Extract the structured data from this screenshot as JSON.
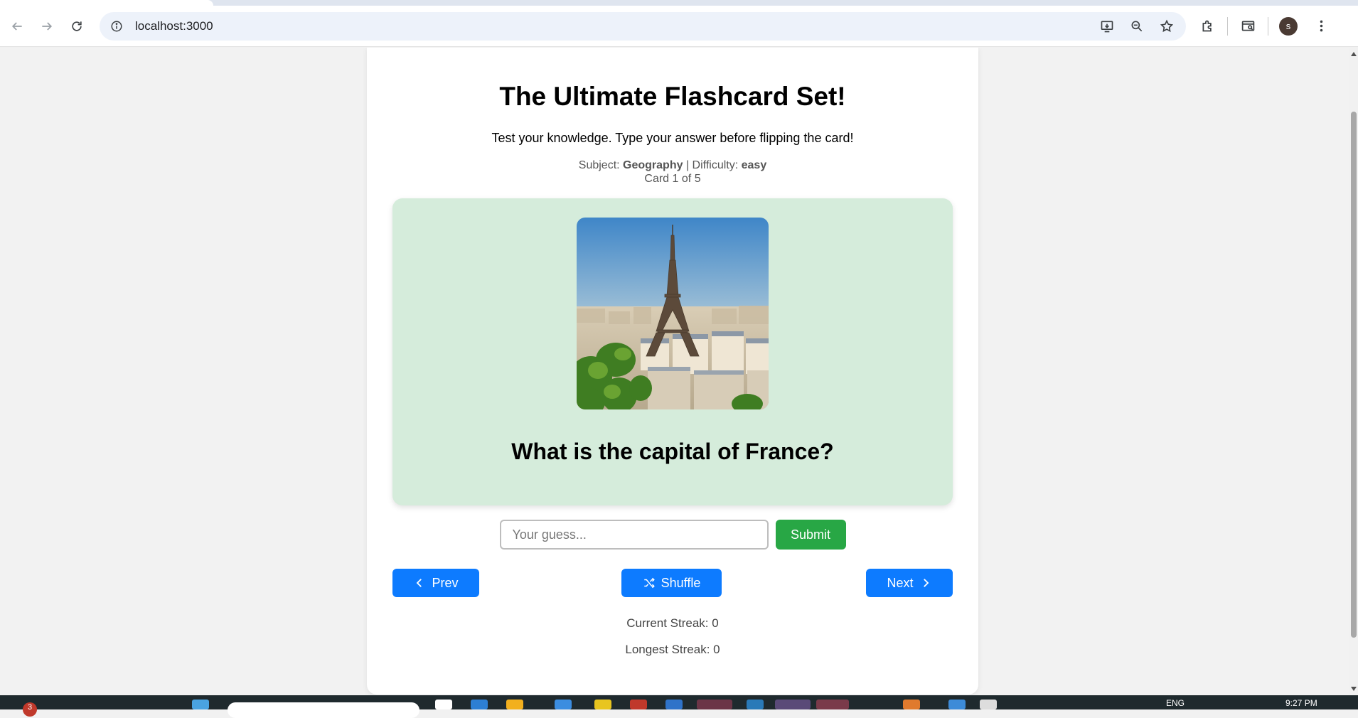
{
  "browser": {
    "url": "localhost:3000",
    "avatar_letter": "s"
  },
  "page": {
    "title": "The Ultimate Flashcard Set!",
    "subtitle": "Test your knowledge. Type your answer before flipping the card!",
    "subject_label": "Subject:",
    "subject_value": "Geography",
    "difficulty_label": "| Difficulty:",
    "difficulty_value": "easy",
    "card_word": "Card",
    "card_current": "1",
    "card_of": "of",
    "card_total": "5"
  },
  "card": {
    "image_icon": "eiffel-tower-photo",
    "question": "What is the capital of France?",
    "background_color": "#d5ecdb"
  },
  "guess": {
    "placeholder": "Your guess...",
    "value": "",
    "submit_label": "Submit"
  },
  "controls": {
    "prev_label": "Prev",
    "shuffle_label": "Shuffle",
    "next_label": "Next",
    "accent_color": "#0d7bff",
    "submit_color": "#28a745"
  },
  "streaks": {
    "current_label": "Current Streak: 0",
    "longest_label": "Longest Streak: 0"
  },
  "taskbar": {
    "badge_count": "3",
    "language": "ENG",
    "time": "9:27 PM"
  }
}
